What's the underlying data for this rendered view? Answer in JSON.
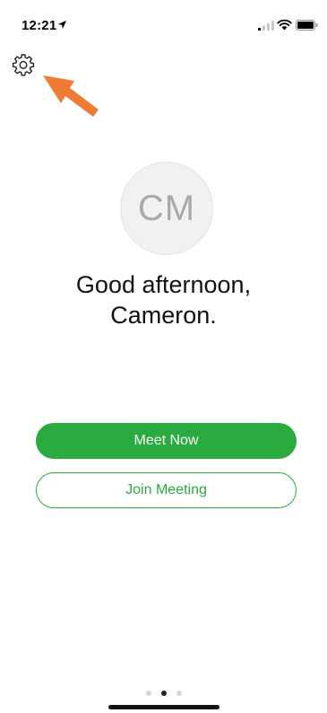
{
  "status_bar": {
    "time": "12:21",
    "icons": [
      "location-arrow-icon",
      "cellular-signal-icon",
      "wifi-icon",
      "battery-icon"
    ]
  },
  "settings": {
    "icon": "gear-icon"
  },
  "annotation": {
    "icon": "arrow-icon",
    "color": "#f07b35"
  },
  "profile": {
    "initials": "CM",
    "avatar_bg": "#f1f1f1",
    "initials_color": "#a9a9a9"
  },
  "greeting": {
    "line1": "Good afternoon,",
    "line2": "Cameron."
  },
  "actions": {
    "meet_now_label": "Meet Now",
    "join_meeting_label": "Join Meeting",
    "accent_color": "#2aab3f"
  },
  "pager": {
    "pages": 3,
    "active_page": 2
  }
}
